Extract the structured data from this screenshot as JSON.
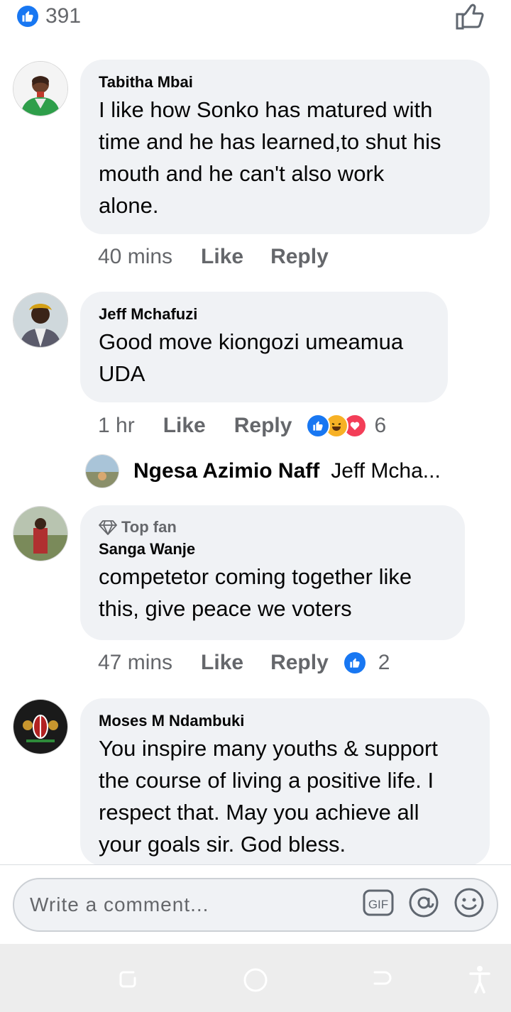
{
  "header": {
    "reaction_count": "391"
  },
  "comments": [
    {
      "author": "Tabitha Mbai",
      "lines": [
        "I like how Sonko has matured with",
        "time and he has learned,to shut his",
        "mouth and he can't also work",
        "alone."
      ],
      "time": "40 mins",
      "like": "Like",
      "reply": "Reply"
    },
    {
      "author": "Jeff Mchafuzi",
      "lines": [
        "Good move kiongozi umeamua",
        "UDA"
      ],
      "time": "1 hr",
      "like": "Like",
      "reply": "Reply",
      "reactions_count": "6"
    },
    {
      "badge": "Top fan",
      "author": "Sanga Wanje",
      "lines": [
        "competetor coming together like",
        "this, give peace we voters"
      ],
      "time": "47 mins",
      "like": "Like",
      "reply": "Reply",
      "reactions_count": "2"
    },
    {
      "author": "Moses M Ndambuki",
      "lines": [
        "You inspire many youths & support",
        "the course of living a positive life. I",
        "respect that. May you achieve all",
        "your goals sir. God bless."
      ]
    }
  ],
  "reply_preview": {
    "author": "Ngesa Azimio Naff",
    "text": "Jeff Mcha..."
  },
  "composer": {
    "placeholder": "Write a comment...",
    "gif_label": "GIF"
  },
  "colors": {
    "accent": "#1877f2",
    "bubble": "#f0f2f5",
    "secondary_text": "#65676b",
    "love": "#f33e58",
    "haha": "#f7b125"
  }
}
